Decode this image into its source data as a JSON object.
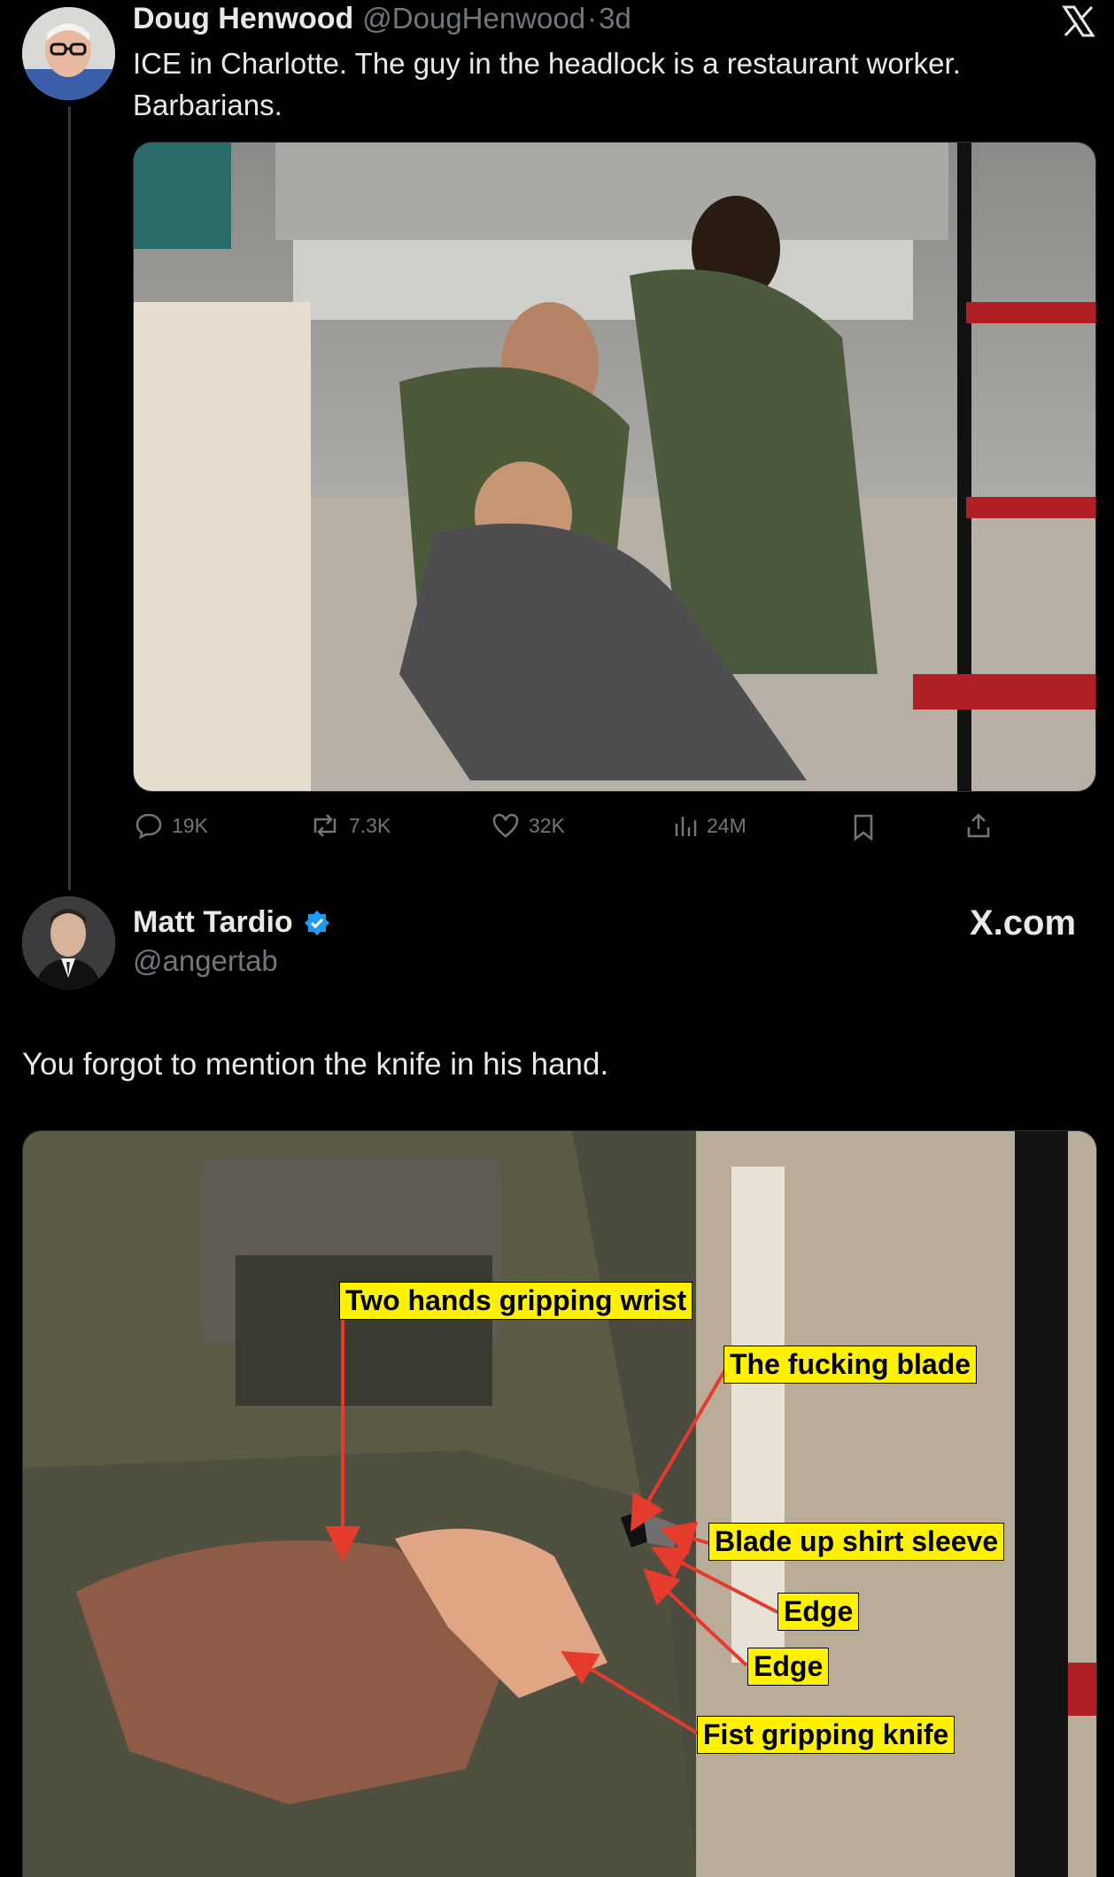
{
  "tweet1": {
    "author_name": "Doug Henwood",
    "handle": "@DougHenwood",
    "separator": "·",
    "time": "3d",
    "text": "ICE in Charlotte. The guy in the headlock is a restaurant worker. Barbarians.",
    "actions": {
      "replies": "19K",
      "reposts": "7.3K",
      "likes": "32K",
      "views": "24M"
    }
  },
  "tweet2": {
    "author_name": "Matt Tardio",
    "handle": "@angertab",
    "site_badge": "X.com",
    "text": "You forgot to mention the knife in his hand.",
    "image_labels": [
      "Two hands gripping wrist",
      "The fucking blade",
      "Blade up shirt sleeve",
      "Edge",
      "Edge",
      "Fist gripping knife"
    ]
  },
  "icons": {
    "logo": "x-logo-icon",
    "verified": "verified-badge-icon",
    "reply": "reply-icon",
    "repost": "repost-icon",
    "like": "heart-icon",
    "views": "views-icon",
    "bookmark": "bookmark-icon",
    "share": "share-icon"
  },
  "colors": {
    "background": "#000000",
    "text": "#e7e9ea",
    "muted": "#71767b",
    "verified": "#1d9bf0",
    "label_bg": "#fff200",
    "arrow": "#e53b2c"
  }
}
